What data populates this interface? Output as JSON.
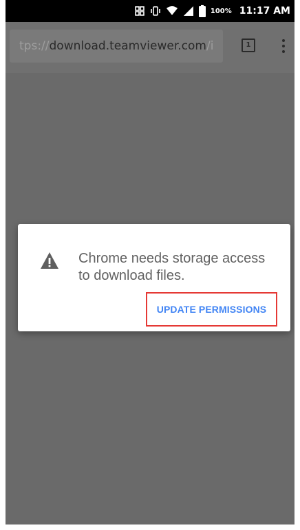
{
  "status_bar": {
    "battery_percent": "100%",
    "time": "11:17 AM",
    "icons": [
      "signal-x-icon",
      "vibrate-icon",
      "wifi-icon",
      "cell-signal-icon",
      "battery-icon"
    ]
  },
  "toolbar": {
    "url_scheme": "tps://",
    "url_host": "download.teamviewer.com",
    "url_path": "/i",
    "tab_count": "1",
    "menu_icon": "overflow-menu-icon"
  },
  "dialog": {
    "icon": "warning-icon",
    "message": "Chrome needs storage access to download files.",
    "action_label": "UPDATE PERMISSIONS",
    "action_color": "#4285f4",
    "highlight_color": "#e53935"
  },
  "colors": {
    "scrim": "#6a6a6a",
    "status_bar": "#000000"
  }
}
